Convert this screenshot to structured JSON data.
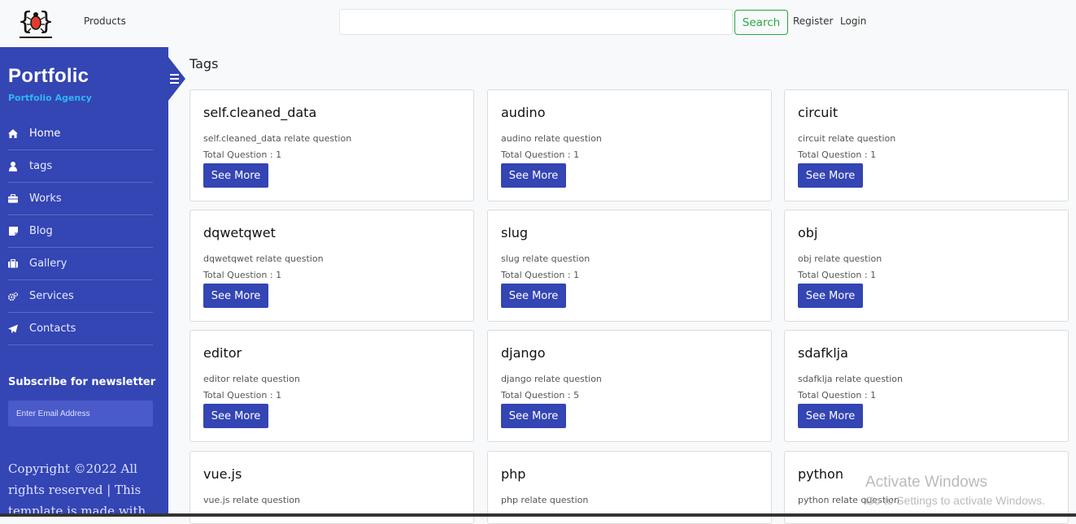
{
  "nav": {
    "products": "Products",
    "search_placeholder": "",
    "search_button": "Search",
    "register": "Register",
    "login": "Login"
  },
  "sidebar": {
    "brand": "Portfolic",
    "subtitle": "Portfolio Agency",
    "items": [
      {
        "label": "Home",
        "icon": "home-icon"
      },
      {
        "label": "tags",
        "icon": "user-icon"
      },
      {
        "label": "Works",
        "icon": "briefcase-icon"
      },
      {
        "label": "Blog",
        "icon": "sticky-note-icon"
      },
      {
        "label": "Gallery",
        "icon": "suitcase-icon"
      },
      {
        "label": "Services",
        "icon": "gears-icon"
      },
      {
        "label": "Contacts",
        "icon": "paper-plane-icon"
      }
    ],
    "newsletter_title": "Subscribe for newsletter",
    "newsletter_placeholder": "Enter Email Address",
    "copyright": "Copyright ©2022 All rights reserved | This template is made with"
  },
  "main": {
    "title": "Tags",
    "cards": [
      {
        "title": "self.cleaned_data",
        "desc": "self.cleaned_data relate question",
        "count": "Total Question : 1",
        "button": "See More"
      },
      {
        "title": "audino",
        "desc": "audino relate question",
        "count": "Total Question : 1",
        "button": "See More"
      },
      {
        "title": "circuit",
        "desc": "circuit relate question",
        "count": "Total Question : 1",
        "button": "See More"
      },
      {
        "title": "dqwetqwet",
        "desc": "dqwetqwet relate question",
        "count": "Total Question : 1",
        "button": "See More"
      },
      {
        "title": "slug",
        "desc": "slug relate question",
        "count": "Total Question : 1",
        "button": "See More"
      },
      {
        "title": "obj",
        "desc": "obj relate question",
        "count": "Total Question : 1",
        "button": "See More"
      },
      {
        "title": "editor",
        "desc": "editor relate question",
        "count": "Total Question : 1",
        "button": "See More"
      },
      {
        "title": "django",
        "desc": "django relate question",
        "count": "Total Question : 5",
        "button": "See More"
      },
      {
        "title": "sdafklja",
        "desc": "sdafklja relate question",
        "count": "Total Question : 1",
        "button": "See More"
      },
      {
        "title": "vue.js",
        "desc": "vue.js relate question",
        "count": "",
        "button": ""
      },
      {
        "title": "php",
        "desc": "php relate question",
        "count": "",
        "button": ""
      },
      {
        "title": "python",
        "desc": "python relate question",
        "count": "",
        "button": ""
      }
    ]
  },
  "watermark": {
    "line1": "Activate Windows",
    "line2": "Go to Settings to activate Windows."
  },
  "colors": {
    "sidebar": "#3445b4",
    "accent_text": "#2fb6f5",
    "search_border": "#28a745"
  }
}
